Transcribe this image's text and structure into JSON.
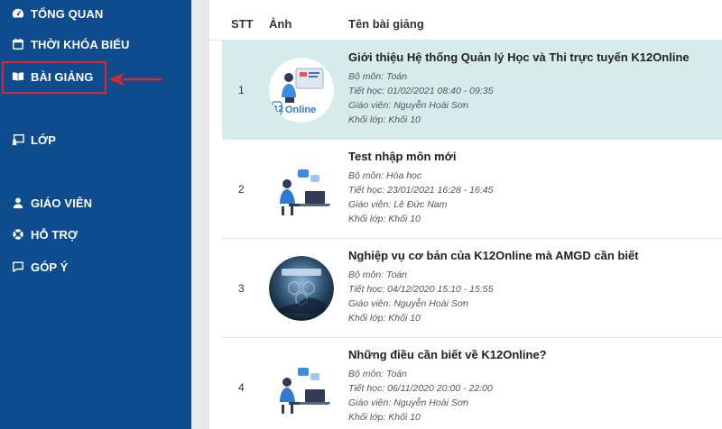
{
  "sidebar": {
    "items": [
      {
        "label": "TỔNG QUAN",
        "icon": "dashboard-icon"
      },
      {
        "label": "THỜI KHÓA BIỂU",
        "icon": "calendar-icon"
      },
      {
        "label": "BÀI GIẢNG",
        "icon": "book-icon"
      },
      {
        "label": "LỚP",
        "icon": "classroom-icon"
      },
      {
        "label": "GIÁO VIÊN",
        "icon": "user-icon"
      },
      {
        "label": "HỖ TRỢ",
        "icon": "lifebuoy-icon"
      },
      {
        "label": "GÓP Ý",
        "icon": "comment-icon"
      }
    ],
    "highlight_color": "#e3242b"
  },
  "table": {
    "headers": {
      "stt": "STT",
      "image": "Ảnh",
      "title": "Tên bài giảng"
    },
    "rows": [
      {
        "stt": "1",
        "title": "Giới thiệu Hệ thống Quản lý Học và Thi trực tuyến K12Online",
        "subject": "Bộ môn: Toán",
        "lesson_time": "Tiết học: 01/02/2021 08:40 - 09:35",
        "teacher": "Giáo viên: Nguyễn Hoài Sơn",
        "grade": "Khối lớp: Khối 10",
        "thumb_text": "12Online",
        "thumb_icon": "teacher-computer-illustration",
        "active": true
      },
      {
        "stt": "2",
        "title": "Test nhập môn mới",
        "subject": "Bộ môn: Hóa học",
        "lesson_time": "Tiết học: 23/01/2021 16:28 - 16:45",
        "teacher": "Giáo viên: Lê Đức Nam",
        "grade": "Khối lớp: Khối 10",
        "thumb_icon": "person-laptop-illustration"
      },
      {
        "stt": "3",
        "title": "Nghiệp vụ cơ bản của K12Online mà AMGD cần biết",
        "subject": "Bộ môn: Toán",
        "lesson_time": "Tiết học: 04/12/2020 15:10 - 15:55",
        "teacher": "Giáo viên: Nguyễn Hoài Sơn",
        "grade": "Khối lớp: Khối 10",
        "thumb_icon": "tech-network-photo"
      },
      {
        "stt": "4",
        "title": "Những điều cần biết về K12Online?",
        "subject": "Bộ môn: Toán",
        "lesson_time": "Tiết học: 06/11/2020 20:00 - 22:00",
        "teacher": "Giáo viên: Nguyễn Hoài Sơn",
        "grade": "Khối lớp: Khối 10",
        "thumb_icon": "person-laptop-illustration"
      }
    ]
  }
}
